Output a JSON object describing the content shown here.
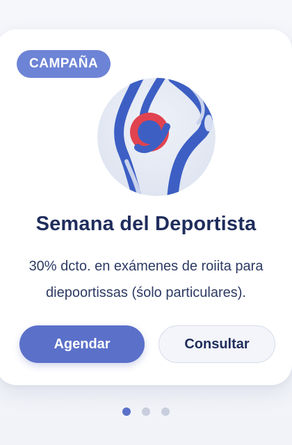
{
  "card": {
    "badge": "CAMPAÑA",
    "illustration_icon": "knee-joint-icon",
    "title": "Semana del Deportista",
    "description_line1": "30% dcto. en exámenes de roiita para",
    "description_line2": "diepoortissas (śolo particulares)."
  },
  "actions": {
    "primary_label": "Agendar",
    "secondary_label": "Consultar"
  },
  "carousel": {
    "total_slides": 3,
    "active_slide": 1
  },
  "colors": {
    "accent": "#5b70c9",
    "badge": "#6d83d6",
    "title": "#1f2d5c",
    "joint_red": "#e0434f",
    "bone_blue": "#3d5fc4"
  }
}
